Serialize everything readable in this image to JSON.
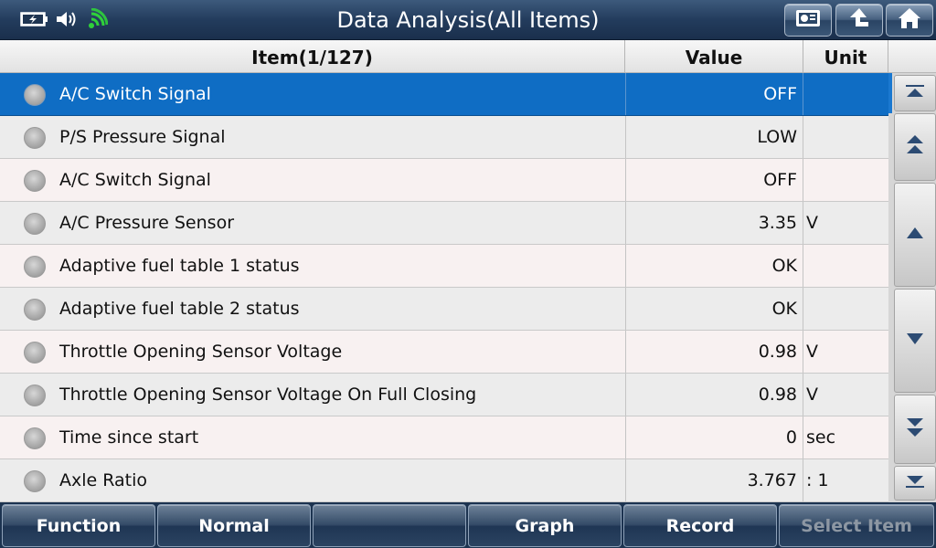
{
  "header": {
    "title": "Data Analysis(All Items)",
    "status_icons": [
      "battery-charging-icon",
      "speaker-icon",
      "wifi-icon"
    ],
    "buttons": [
      "snapshot-icon",
      "back-icon",
      "home-icon"
    ]
  },
  "table": {
    "columns": {
      "item": "Item(1/127)",
      "value": "Value",
      "unit": "Unit"
    },
    "rows": [
      {
        "name": "A/C Switch Signal",
        "value": "OFF",
        "unit": ""
      },
      {
        "name": "P/S Pressure Signal",
        "value": "LOW",
        "unit": ""
      },
      {
        "name": "A/C Switch Signal",
        "value": "OFF",
        "unit": ""
      },
      {
        "name": "A/C Pressure Sensor",
        "value": "3.35",
        "unit": "V"
      },
      {
        "name": "Adaptive fuel table 1 status",
        "value": "OK",
        "unit": ""
      },
      {
        "name": "Adaptive fuel table 2 status",
        "value": "OK",
        "unit": ""
      },
      {
        "name": "Throttle Opening Sensor Voltage",
        "value": "0.98",
        "unit": "V"
      },
      {
        "name": "Throttle Opening Sensor Voltage On Full Closing",
        "value": "0.98",
        "unit": "V"
      },
      {
        "name": "Time since start",
        "value": "0",
        "unit": "sec"
      },
      {
        "name": "Axle Ratio",
        "value": "3.767",
        "unit": ": 1"
      }
    ]
  },
  "scroll": {
    "buttons": [
      "scroll-top-icon",
      "page-up-icon",
      "scroll-up-icon",
      "scroll-down-icon",
      "page-down-icon",
      "scroll-bottom-icon"
    ]
  },
  "footer": {
    "buttons": [
      "Function",
      "Normal",
      "",
      "Graph",
      "Record",
      "Select Item"
    ]
  },
  "colors": {
    "selected_row": "#0f6dc4",
    "title_bar": "#233c5d",
    "wifi": "#2fd13a"
  }
}
